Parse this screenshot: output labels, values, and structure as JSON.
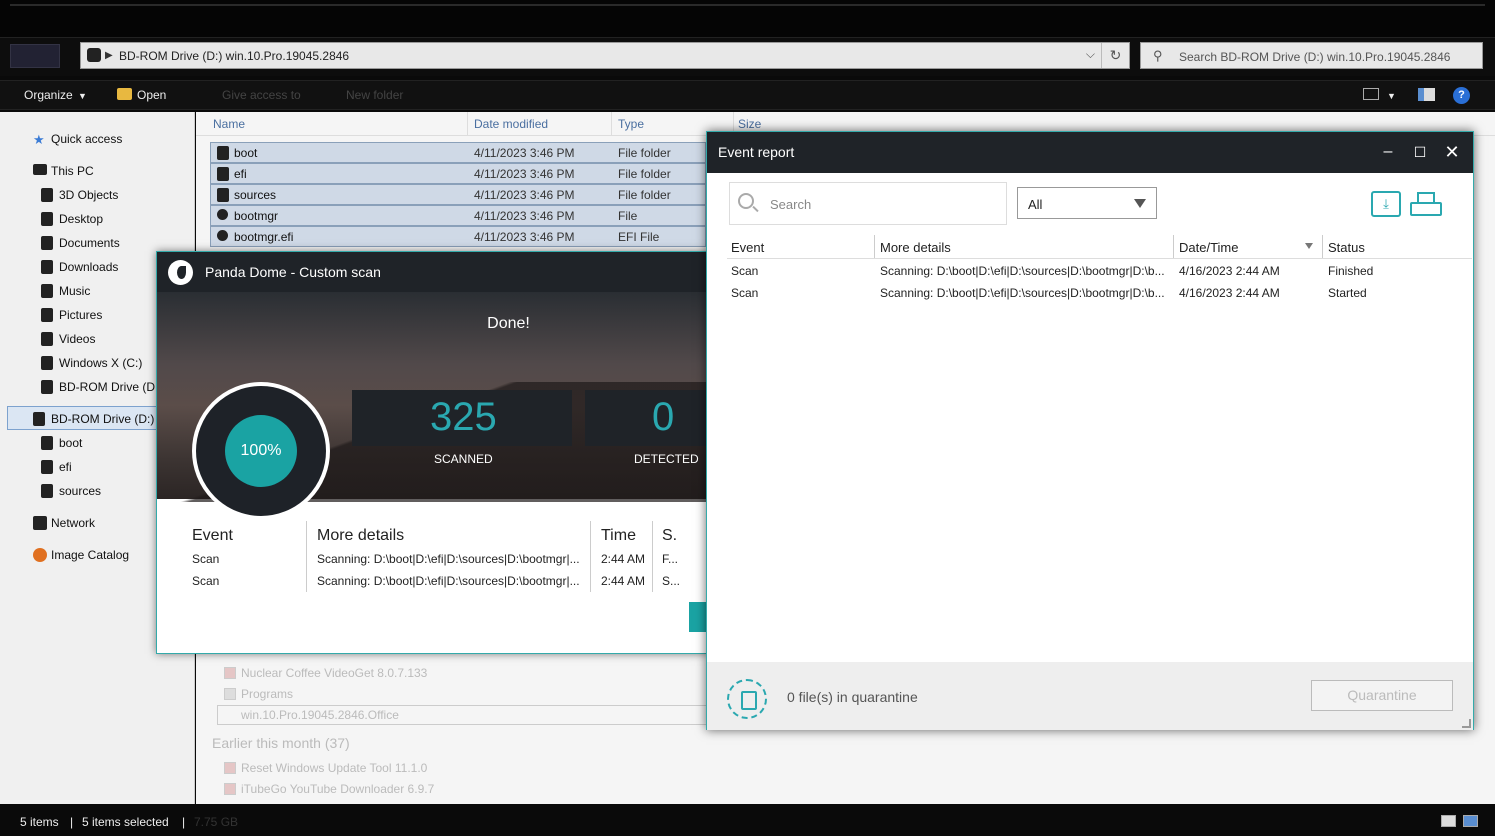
{
  "explorer": {
    "address": "BD-ROM Drive (D:) win.10.Pro.19045.2846",
    "search_placeholder": "Search BD-ROM Drive (D:) win.10.Pro.19045.2846",
    "toolbar": {
      "organize": "Organize",
      "open": "Open",
      "share": "Give access to",
      "new_folder": "New folder"
    },
    "columns": {
      "name": "Name",
      "date": "Date modified",
      "type": "Type",
      "size": "Size"
    },
    "nav": {
      "quick_access": "Quick access",
      "this_pc": "This PC",
      "items": [
        "3D Objects",
        "Desktop",
        "Documents",
        "Downloads",
        "Music",
        "Pictures",
        "Videos",
        "Windows X (C:)",
        "BD-ROM Drive (D:)"
      ],
      "selected": "BD-ROM Drive (D:) v",
      "sub": [
        "boot",
        "efi",
        "sources"
      ],
      "network": "Network",
      "catalog": "Image Catalog"
    },
    "files": [
      {
        "name": "boot",
        "date": "4/11/2023 3:46 PM",
        "type": "File folder"
      },
      {
        "name": "efi",
        "date": "4/11/2023 3:46 PM",
        "type": "File folder"
      },
      {
        "name": "sources",
        "date": "4/11/2023 3:46 PM",
        "type": "File folder"
      },
      {
        "name": "bootmgr",
        "date": "4/11/2023 3:46 PM",
        "type": "File"
      },
      {
        "name": "bootmgr.efi",
        "date": "4/11/2023 3:46 PM",
        "type": "EFI File"
      }
    ],
    "background_items": [
      "Nuclear Coffee VideoGet 8.0.7.133",
      "Programs",
      "win.10.Pro.19045.2846.Office",
      "Earlier this month (37)",
      "Reset Windows Update Tool 11.1.0",
      "iTubeGo YouTube Downloader 6.9.7"
    ],
    "status": {
      "count": "5 items",
      "selected": "5 items selected",
      "size": "7.75 GB"
    }
  },
  "panda": {
    "title": "Panda Dome - Custom scan",
    "done": "Done!",
    "progress": "100%",
    "progress_value": 100,
    "scanned_value": "325",
    "scanned_label": "SCANNED",
    "detected_value": "0",
    "detected_label": "DETECTED",
    "table": {
      "headers": {
        "event": "Event",
        "details": "More details",
        "time": "Time",
        "status": "S."
      },
      "rows": [
        {
          "event": "Scan",
          "details": "Scanning: D:\\boot|D:\\efi|D:\\sources|D:\\bootmgr|...",
          "time": "2:44 AM",
          "status": "F..."
        },
        {
          "event": "Scan",
          "details": "Scanning: D:\\boot|D:\\efi|D:\\sources|D:\\bootmgr|...",
          "time": "2:44 AM",
          "status": "S..."
        }
      ]
    }
  },
  "event_report": {
    "title": "Event report",
    "search_placeholder": "Search",
    "filter_value": "All",
    "headers": {
      "event": "Event",
      "details": "More details",
      "datetime": "Date/Time",
      "status": "Status"
    },
    "rows": [
      {
        "event": "Scan",
        "details": "Scanning: D:\\boot|D:\\efi|D:\\sources|D:\\bootmgr|D:\\b...",
        "datetime": "4/16/2023 2:44 AM",
        "status": "Finished"
      },
      {
        "event": "Scan",
        "details": "Scanning: D:\\boot|D:\\efi|D:\\sources|D:\\bootmgr|D:\\b...",
        "datetime": "4/16/2023 2:44 AM",
        "status": "Started"
      }
    ],
    "quarantine_count": "0 file(s) in quarantine",
    "quarantine_button": "Quarantine"
  },
  "colors": {
    "accent": "#2aa8b0",
    "dark": "#1f2328"
  }
}
